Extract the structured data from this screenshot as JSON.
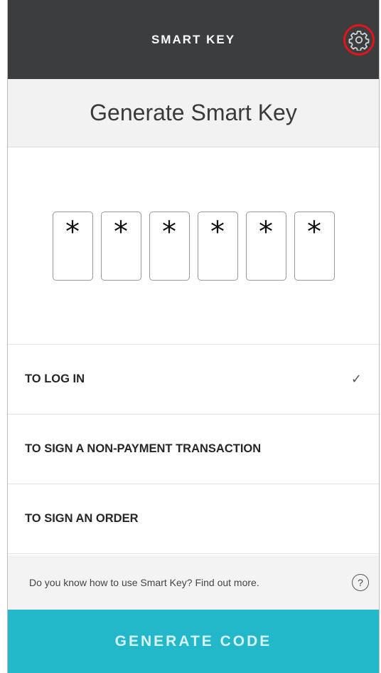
{
  "header": {
    "title": "SMART KEY",
    "settings_icon": "gear-icon"
  },
  "subheader": {
    "title": "Generate Smart Key"
  },
  "code": {
    "digits": [
      "*",
      "*",
      "*",
      "*",
      "*",
      "*"
    ]
  },
  "options": [
    {
      "label": "TO LOG IN",
      "selected": true,
      "check": "✓"
    },
    {
      "label": "TO SIGN A NON-PAYMENT TRANSACTION",
      "selected": false
    },
    {
      "label": "TO SIGN AN ORDER",
      "selected": false
    }
  ],
  "footer": {
    "info_text": "Do you know how to use Smart Key? Find out more.",
    "help_symbol": "?",
    "generate_label": "GENERATE CODE"
  },
  "colors": {
    "topbar": "#3c3d3f",
    "accent": "#23b8c9",
    "highlight_ring": "#e0141c"
  }
}
